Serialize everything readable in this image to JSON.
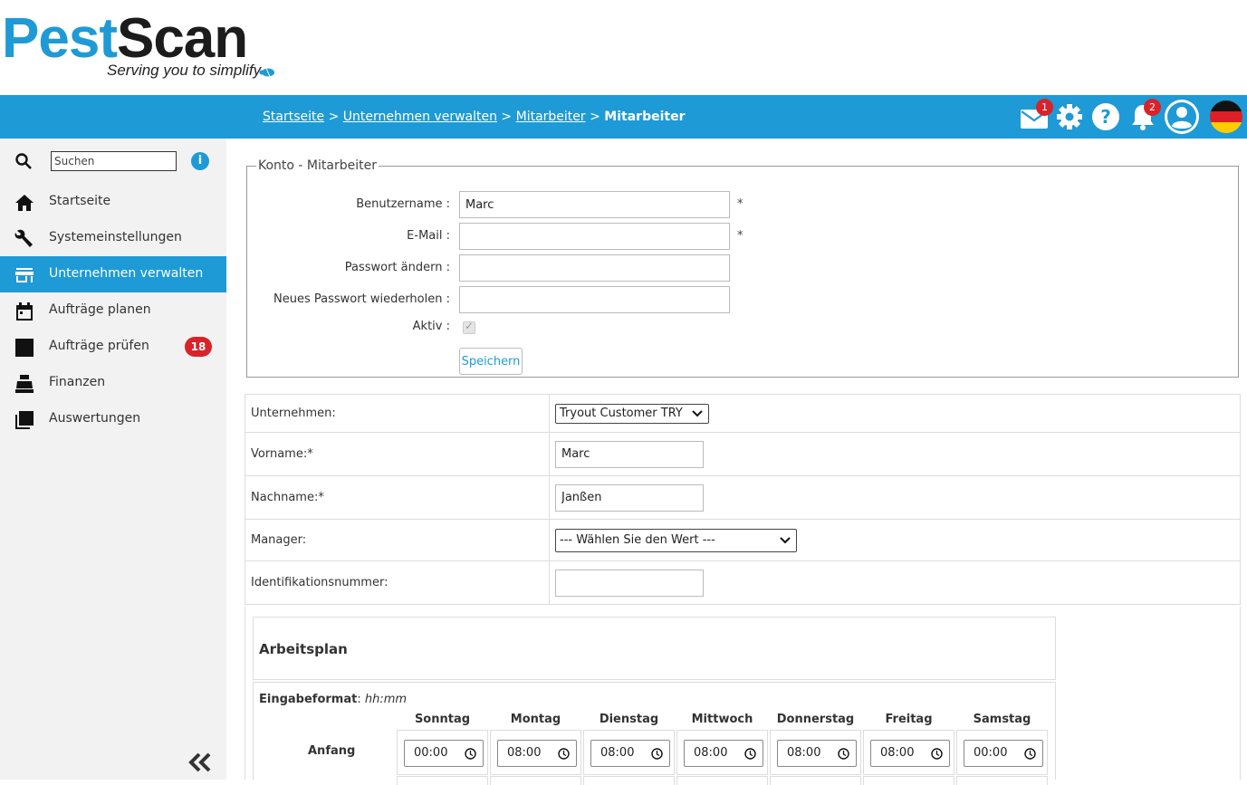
{
  "brand": {
    "pest": "Pest",
    "scan": "Scan",
    "tagline": "Serving you to simplify"
  },
  "breadcrumb": {
    "items": [
      "Startseite",
      "Unternehmen verwalten",
      "Mitarbeiter"
    ],
    "current": "Mitarbeiter",
    "separator": ">"
  },
  "topbar": {
    "mail_badge": "1",
    "notification_badge": "2"
  },
  "sidebar": {
    "search_placeholder": "Suchen",
    "info": "i",
    "items": [
      {
        "label": "Startseite",
        "icon": "home-icon"
      },
      {
        "label": "Systemeinstellungen",
        "icon": "wrench-icon"
      },
      {
        "label": "Unternehmen verwalten",
        "icon": "store-icon",
        "active": true
      },
      {
        "label": "Aufträge planen",
        "icon": "calendar-icon"
      },
      {
        "label": "Aufträge prüfen",
        "icon": "checklist-icon",
        "badge": "18"
      },
      {
        "label": "Finanzen",
        "icon": "cash-register-icon"
      },
      {
        "label": "Auswertungen",
        "icon": "report-icon"
      }
    ]
  },
  "konto": {
    "legend": "Konto - Mitarbeiter",
    "username_label": "Benutzername :",
    "username_value": "Marc",
    "email_label": "E-Mail :",
    "email_value": "",
    "password_label": "Passwort ändern :",
    "password_repeat_label": "Neues Passwort wiederholen :",
    "active_label": "Aktiv :",
    "required_mark": "*",
    "save_label": "Speichern"
  },
  "details": {
    "company_label": "Unternehmen:",
    "company_value": "Tryout Customer TRY",
    "firstname_label": "Vorname:*",
    "firstname_value": "Marc",
    "lastname_label": "Nachname:*",
    "lastname_value": "Janßen",
    "manager_label": "Manager:",
    "manager_value": "--- Wählen Sie den Wert ---",
    "idnumber_label": "Identifikationsnummer:",
    "idnumber_value": ""
  },
  "plan": {
    "title": "Arbeitsplan",
    "format_label": "Eingabeformat",
    "format_value": "hh:mm",
    "row_label": "Anfang",
    "days": [
      "Sonntag",
      "Montag",
      "Dienstag",
      "Mittwoch",
      "Donnerstag",
      "Freitag",
      "Samstag"
    ],
    "start_times": [
      "00:00",
      "08:00",
      "08:00",
      "08:00",
      "08:00",
      "08:00",
      "00:00"
    ]
  },
  "colors": {
    "accent": "#1e9ad6",
    "badge": "#d9222a",
    "sidebar_bg": "#f2f2f2"
  }
}
